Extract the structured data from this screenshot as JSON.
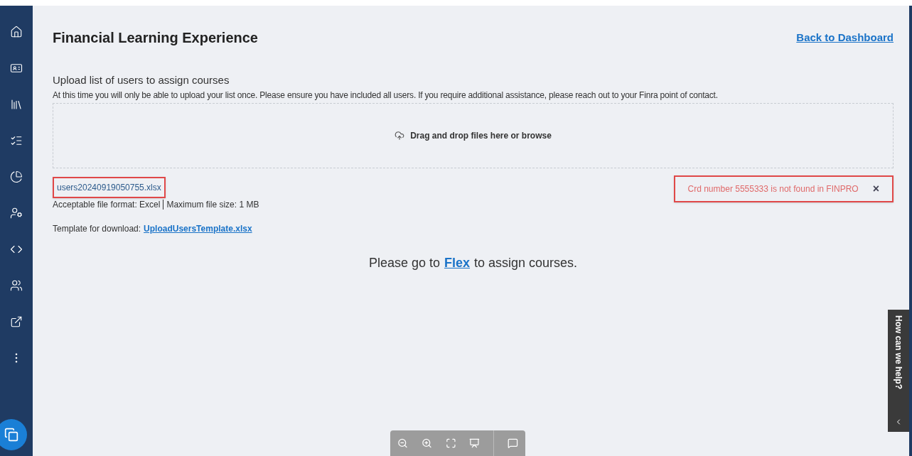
{
  "page": {
    "title": "Financial Learning Experience",
    "back_link": "Back to Dashboard"
  },
  "upload": {
    "heading": "Upload list of users to assign courses",
    "notice": "At this time you will only be able to upload your list once. Please ensure you have included all users. If you require additional assistance, please reach out to your Finra point of contact.",
    "dropzone": "Drag and drop files here or browse"
  },
  "file": {
    "name": "users20240919050755.xlsx",
    "highlighted": true
  },
  "error": {
    "message": "Crd number 5555333 is not found in FINPRO",
    "close": "×",
    "highlighted": true
  },
  "formats": {
    "format": "Acceptable file format: Excel",
    "size": "Maximum file size: 1 MB"
  },
  "template": {
    "label": "Template for download:",
    "link": "UploadUsersTemplate.xlsx"
  },
  "flex_message": {
    "before": "Please go to",
    "link": "Flex",
    "after": "to assign courses."
  },
  "help_tab": {
    "label": "How can we help?"
  }
}
